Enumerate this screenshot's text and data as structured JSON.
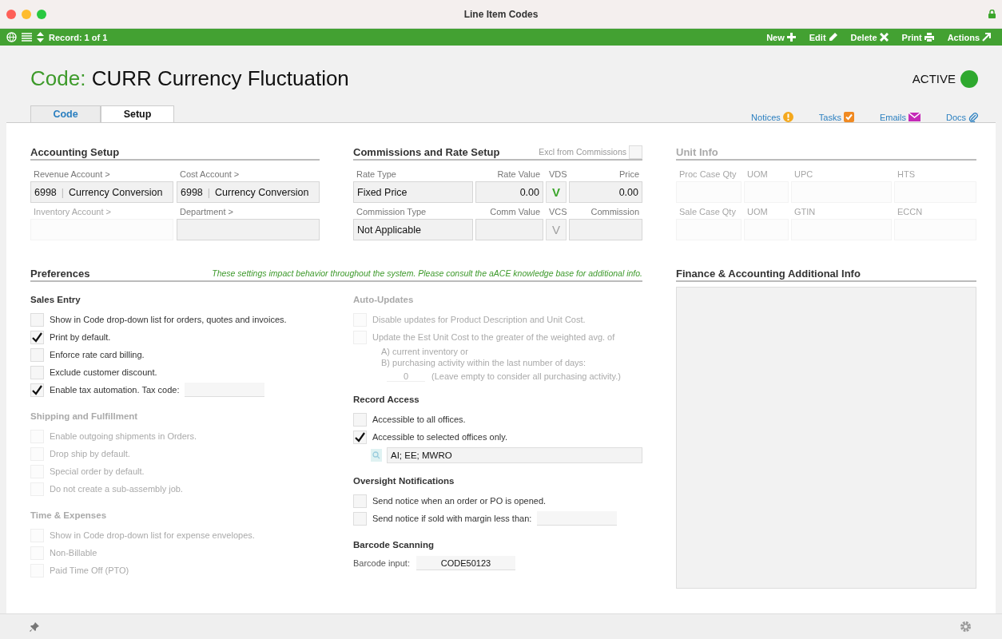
{
  "window": {
    "title": "Line Item Codes"
  },
  "toolbar": {
    "record": "Record: 1 of 1",
    "actions": [
      {
        "label": "New",
        "kind": "new"
      },
      {
        "label": "Edit",
        "kind": "edit"
      },
      {
        "label": "Delete",
        "kind": "delete"
      },
      {
        "label": "Print",
        "kind": "print"
      },
      {
        "label": "Actions",
        "kind": "actions"
      }
    ]
  },
  "header": {
    "prefix": "Code:",
    "title": "CURR Currency Fluctuation",
    "status": "ACTIVE",
    "active": true
  },
  "tabs": [
    {
      "label": "Code",
      "selected": false
    },
    {
      "label": "Setup",
      "selected": true
    }
  ],
  "links": [
    {
      "label": "Notices",
      "kind": "notices"
    },
    {
      "label": "Tasks",
      "kind": "tasks"
    },
    {
      "label": "Emails",
      "kind": "emails"
    },
    {
      "label": "Docs",
      "kind": "docs"
    }
  ],
  "accounting": {
    "title": "Accounting Setup",
    "fields": [
      {
        "label": "Revenue Account >",
        "disabled": false,
        "code": "6998",
        "separator": "|",
        "name": "Currency Conversion"
      },
      {
        "label": "Cost Account >",
        "disabled": false,
        "code": "6998",
        "separator": "|",
        "name": "Currency Conversion"
      },
      {
        "label": "Inventory Account >",
        "disabled": true
      },
      {
        "label": "Department >",
        "disabled": false
      }
    ]
  },
  "commissions": {
    "title": "Commissions and Rate Setup",
    "exclude_label": "Excl from Commissions",
    "exclude_checked": false,
    "rows": [
      {
        "labels": [
          "Rate Type",
          "Rate Value",
          "VDS",
          "Price"
        ],
        "type": "Fixed Price",
        "value": "0.00",
        "flag": "V",
        "flag_on": true,
        "amount": "0.00"
      },
      {
        "labels": [
          "Commission Type",
          "Comm Value",
          "VCS",
          "Commission"
        ],
        "type": "Not Applicable",
        "flag": "V",
        "flag_on": false
      }
    ]
  },
  "unit_info": {
    "title": "Unit Info",
    "disabled": true,
    "rows": [
      {
        "labels": [
          "Proc Case Qty",
          "UOM",
          "UPC",
          "HTS"
        ]
      },
      {
        "labels": [
          "Sale Case Qty",
          "UOM",
          "GTIN",
          "ECCN"
        ]
      }
    ]
  },
  "preferences": {
    "title": "Preferences",
    "note": "These settings impact behavior throughout the system. Please consult the aACE knowledge base for additional info."
  },
  "left_groups": [
    {
      "title": "Sales Entry",
      "disabled": false,
      "kind": "checks",
      "items": [
        {
          "kind": "check",
          "label": "Show in Code drop-down list for orders, quotes and invoices.",
          "checked": false
        },
        {
          "kind": "check",
          "label": "Print by default.",
          "checked": true
        },
        {
          "kind": "check",
          "label": "Enforce rate card billing.",
          "checked": false
        },
        {
          "kind": "check",
          "label": "Exclude customer discount.",
          "checked": false
        },
        {
          "kind": "field",
          "label": "Enable tax automation. Tax code:",
          "checked": true
        }
      ]
    },
    {
      "title": "Shipping and Fulfillment",
      "disabled": true,
      "kind": "checks",
      "items": [
        {
          "kind": "check",
          "label": "Enable outgoing shipments in Orders.",
          "checked": false
        },
        {
          "kind": "check",
          "label": "Drop ship by default.",
          "checked": false
        },
        {
          "kind": "check",
          "label": "Special order by default.",
          "checked": false
        },
        {
          "kind": "check",
          "label": "Do not create a sub-assembly job.",
          "checked": false
        }
      ]
    },
    {
      "title": "Time & Expenses",
      "disabled": true,
      "kind": "checks",
      "items": [
        {
          "kind": "check",
          "label": "Show in Code drop-down list for expense envelopes.",
          "checked": false
        },
        {
          "kind": "check",
          "label": "Non-Billable",
          "checked": false
        },
        {
          "kind": "check",
          "label": "Paid Time Off (PTO)",
          "checked": false
        }
      ]
    }
  ],
  "right_groups": [
    {
      "title": "Auto-Updates",
      "disabled": true,
      "kind": "checks",
      "items": [
        {
          "kind": "check",
          "label": "Disable updates for Product Description and Unit Cost.",
          "checked": false
        },
        {
          "kind": "update",
          "label": "Update the Est Unit Cost to the greater of the weighted avg. of",
          "checked": false,
          "lines": [
            "A) current inventory or",
            "B) purchasing activity within the last number of days:"
          ],
          "days": "0",
          "hint": "(Leave empty to consider all purchasing activity.)"
        }
      ]
    },
    {
      "title": "Record Access",
      "disabled": false,
      "kind": "checks",
      "items": [
        {
          "kind": "check",
          "label": "Accessible to all offices.",
          "checked": false
        },
        {
          "kind": "offices",
          "label": "Accessible to selected offices only.",
          "checked": true,
          "offices": "AI; EE; MWRO"
        }
      ]
    },
    {
      "title": "Oversight Notifications",
      "disabled": false,
      "kind": "checks",
      "items": [
        {
          "kind": "check",
          "label": "Send notice when an order or PO is opened.",
          "checked": false
        },
        {
          "kind": "field",
          "label": "Send notice if sold with margin less than:",
          "checked": false
        }
      ]
    },
    {
      "title": "Barcode Scanning",
      "disabled": false,
      "kind": "barcode",
      "label": "Barcode input:",
      "value": "CODE50123"
    }
  ],
  "finance": {
    "title": "Finance & Accounting Additional Info"
  }
}
